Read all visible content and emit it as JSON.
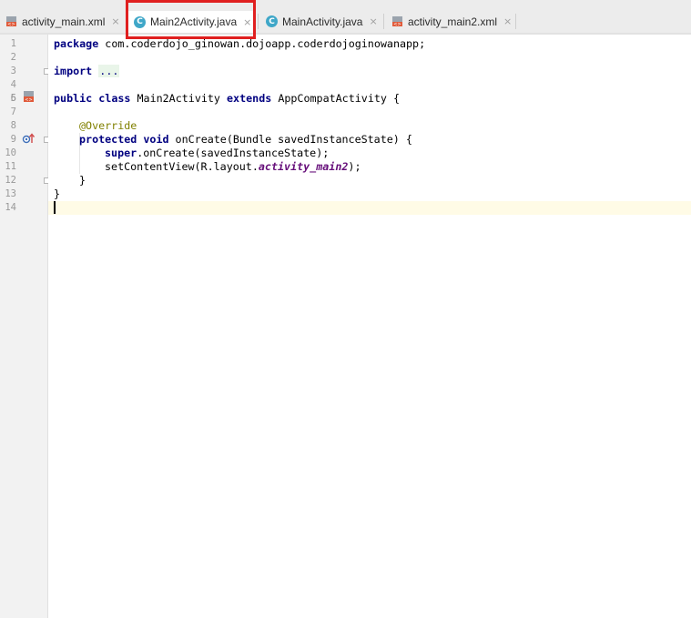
{
  "tabs": [
    {
      "label": "activity_main.xml",
      "icon": "xml-layout-icon",
      "active": false
    },
    {
      "label": "Main2Activity.java",
      "icon": "java-class-icon",
      "active": true
    },
    {
      "label": "MainActivity.java",
      "icon": "java-class-icon",
      "active": false
    },
    {
      "label": "activity_main2.xml",
      "icon": "xml-layout-icon",
      "active": false
    }
  ],
  "tab_close_glyph": "×",
  "class_icon_letter": "C",
  "line_numbers": [
    "1",
    "2",
    "3",
    "4",
    "5",
    "6",
    "7",
    "8",
    "9",
    "10",
    "11",
    "12",
    "13",
    "14"
  ],
  "code": {
    "l1_kw": "package",
    "l1_rest": " com.coderdojo_ginowan.dojoapp.coderdojoginowanapp;",
    "l3_kw": "import",
    "l3_fold": "...",
    "l6_kw1": "public class",
    "l6_name": " Main2Activity ",
    "l6_kw2": "extends",
    "l6_rest": " AppCompatActivity {",
    "l8_ann": "@Override",
    "l9_kw": "protected void",
    "l9_rest": " onCreate(Bundle savedInstanceState) {",
    "l10_kw": "super",
    "l10_rest": ".onCreate(savedInstanceState);",
    "l11_a": "setContentView(R.layout.",
    "l11_b": "activity_main2",
    "l11_c": ");",
    "l12": "}",
    "l13": "}"
  },
  "colors": {
    "keyword": "#000080",
    "annotation": "#808000",
    "field": "#660e7a",
    "highlight_box": "#e02020",
    "class_icon": "#3fa7c8"
  }
}
